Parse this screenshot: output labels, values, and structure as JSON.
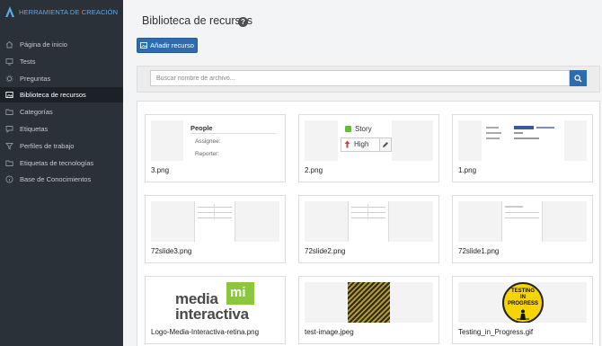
{
  "brand": {
    "name": "HERRAMIENTA DE CREACIÓN"
  },
  "sidebar": {
    "items": [
      {
        "label": "Página de inicio",
        "icon": "home-icon"
      },
      {
        "label": "Tests",
        "icon": "monitor-icon"
      },
      {
        "label": "Preguntas",
        "icon": "gear-icon"
      },
      {
        "label": "Biblioteca de recursos",
        "icon": "image-icon",
        "active": true
      },
      {
        "label": "Categorías",
        "icon": "folder-icon"
      },
      {
        "label": "Etiquetas",
        "icon": "comment-icon"
      },
      {
        "label": "Perfiles de trabajo",
        "icon": "filter-icon"
      },
      {
        "label": "Etiquetas de tecnologías",
        "icon": "folder-icon"
      },
      {
        "label": "Base de Conocimientos",
        "icon": "info-icon"
      }
    ]
  },
  "page": {
    "title": "Biblioteca de recursos",
    "help": "?"
  },
  "toolbar": {
    "add_label": "Añadir recurso"
  },
  "search": {
    "placeholder": "Buscar nombre de archivo..."
  },
  "assets": [
    {
      "filename": "3.png",
      "thumb_text": [
        "People",
        "Assignee:",
        "Reporter:"
      ]
    },
    {
      "filename": "2.png",
      "thumb_text": [
        "Story",
        "High"
      ]
    },
    {
      "filename": "1.png"
    },
    {
      "filename": "72slide3.png"
    },
    {
      "filename": "72slide2.png"
    },
    {
      "filename": "72slide1.png"
    },
    {
      "filename": "Logo-Media-Interactiva-retina.png",
      "thumb_text": [
        "media",
        "mi",
        "interactiva"
      ]
    },
    {
      "filename": "test-image.jpeg"
    },
    {
      "filename": "Testing_in_Progress.gif",
      "thumb_text": [
        "TESTING",
        "IN",
        "PROGRESS"
      ]
    }
  ],
  "colors": {
    "sidebar_bg": "#2b3138",
    "accent": "#2d6cae",
    "brand": "#5aa9e6",
    "logo_green": "#8cc63f"
  }
}
